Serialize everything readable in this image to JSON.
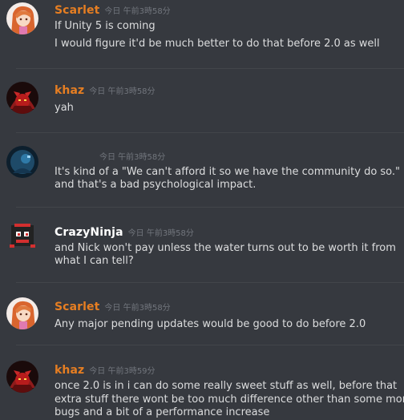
{
  "colors": {
    "background": "#36393f",
    "divider": "#42454a",
    "message_text": "#dcddde",
    "timestamp": "#72767d",
    "username_orange": "#e67e22",
    "username_white": "#ffffff"
  },
  "messages": [
    {
      "author": "Scarlet",
      "author_color": "#e67e22",
      "timestamp": "今日 午前3時58分",
      "avatar_icon": "anime-girl-avatar",
      "lines": [
        "If Unity 5 is coming",
        "I would figure it'd be much better to do that before 2.0 as well"
      ]
    },
    {
      "author": "khaz",
      "author_color": "#e67e22",
      "timestamp": "今日 午前3時58分",
      "avatar_icon": "red-demon-avatar",
      "lines": [
        "yah"
      ]
    },
    {
      "author": "",
      "author_color": "#ffffff",
      "timestamp": "今日 午前3時58分",
      "avatar_icon": "robot-avatar",
      "lines": [
        "It's kind of a \"We can't afford it so we have the community do so.\"",
        "and that's a bad psychological impact."
      ]
    },
    {
      "author": "CrazyNinja",
      "author_color": "#ffffff",
      "timestamp": "今日 午前3時58分",
      "avatar_icon": "pixel-ninja-avatar",
      "lines": [
        "and Nick won't pay unless the water turns out to be worth it from",
        "what I can tell?"
      ]
    },
    {
      "author": "Scarlet",
      "author_color": "#e67e22",
      "timestamp": "今日 午前3時58分",
      "avatar_icon": "anime-girl-avatar",
      "lines": [
        "Any major pending updates would be good to do before 2.0"
      ]
    },
    {
      "author": "khaz",
      "author_color": "#e67e22",
      "timestamp": "今日 午前3時59分",
      "avatar_icon": "red-demon-avatar",
      "lines": [
        "once 2.0 is in i can do some really sweet stuff as well, before that",
        "extra stuff there wont be too much difference other than some more",
        "bugs and a bit of a performance increase"
      ]
    }
  ]
}
